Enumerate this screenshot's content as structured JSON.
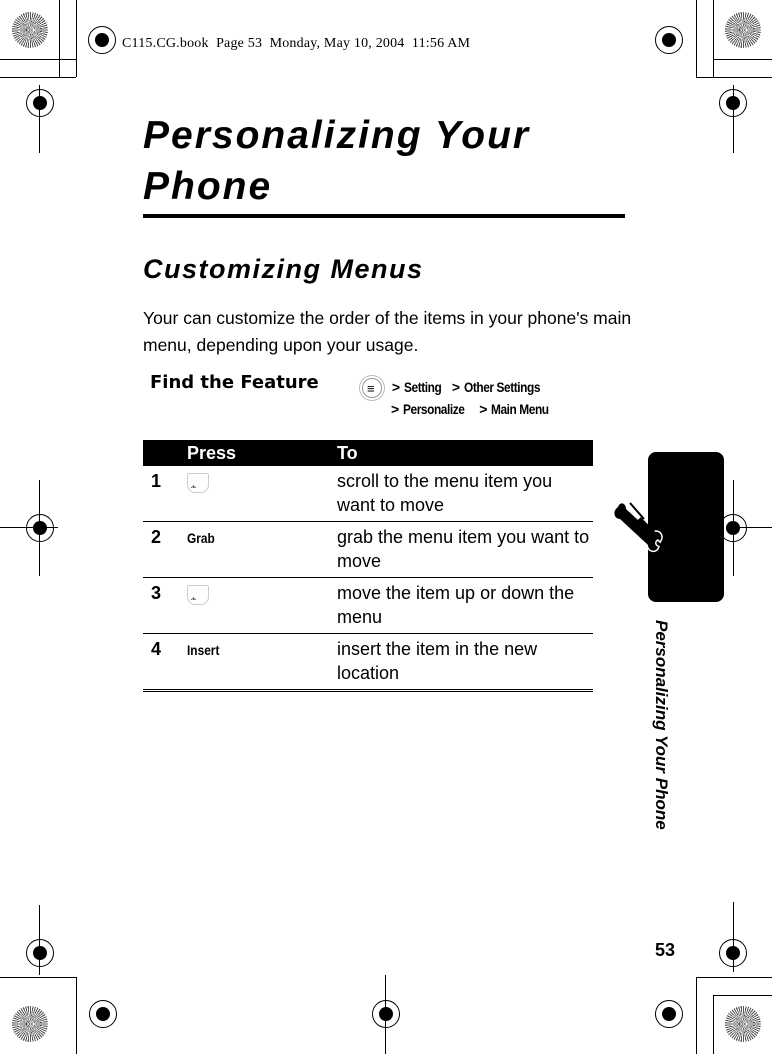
{
  "print_header": "C115.CG.book  Page 53  Monday, May 10, 2004  11:56 AM",
  "page": {
    "title": "Personalizing Your Phone",
    "section_title": "Customizing Menus",
    "intro": "Your can customize the order of the items in your phone's main menu, depending upon your usage."
  },
  "find_feature": {
    "label": "Find the Feature",
    "start_key_icon": "menu-key-icon",
    "path_line1": [
      "Setting",
      "Other Settings"
    ],
    "path_line2": [
      "Personalize",
      "Main Menu"
    ],
    "separator": ">"
  },
  "steps_table": {
    "headers": [
      "Press",
      "To"
    ],
    "rows": [
      {
        "num": "1",
        "press_icon": "nav-key-icon",
        "press": "",
        "to": "scroll to the menu item you want to move"
      },
      {
        "num": "2",
        "press_icon": "",
        "press": "Grab",
        "to": "grab the menu item you want to move"
      },
      {
        "num": "3",
        "press_icon": "nav-key-icon",
        "press": "",
        "to": "move the item up or down the menu"
      },
      {
        "num": "4",
        "press_icon": "",
        "press": "Insert",
        "to": "insert the item in the new location"
      }
    ]
  },
  "side_tab": {
    "icon": "wrench-screwdriver-icon",
    "label": "Personalizing Your Phone"
  },
  "page_number": "53"
}
